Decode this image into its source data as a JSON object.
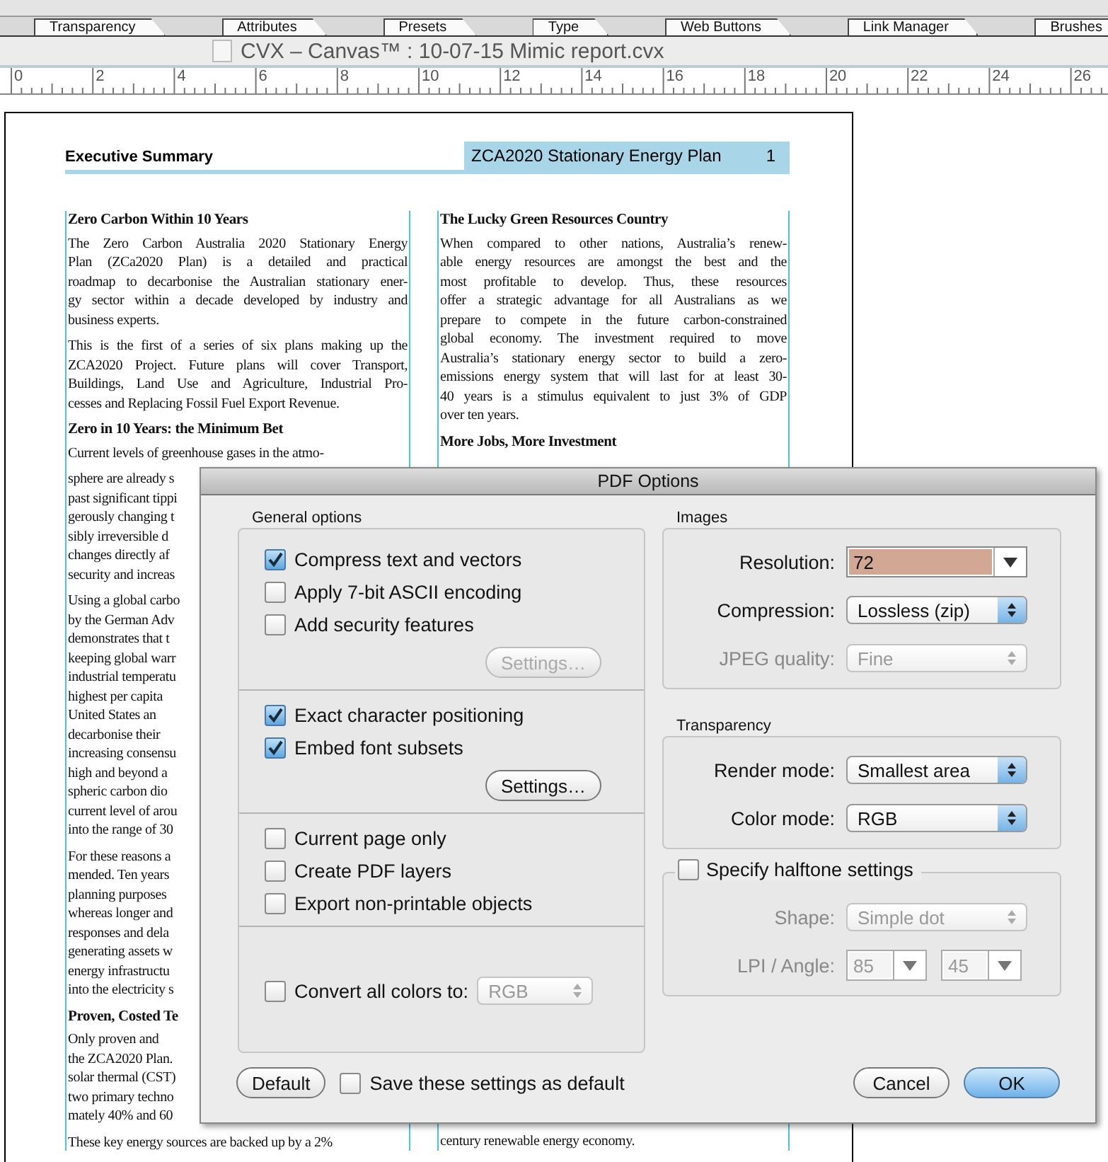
{
  "panel_tabs": [
    {
      "label": "Transparency"
    },
    {
      "label": "Attributes"
    },
    {
      "label": "Presets"
    },
    {
      "label": "Type"
    },
    {
      "label": "Web Buttons"
    },
    {
      "label": "Link Manager"
    },
    {
      "label": "Brushes"
    }
  ],
  "document_title": "CVX – Canvas™ : 10-07-15 Mimic report.cvx",
  "ruler": {
    "labels": [
      "0",
      "2",
      "4",
      "6",
      "8",
      "10",
      "12",
      "14",
      "16",
      "18",
      "20",
      "22",
      "24",
      "26"
    ]
  },
  "page": {
    "header_title": "Executive Summary",
    "running_head": "ZCA2020 Stationary Energy Plan",
    "page_number": "1",
    "left_column": [
      {
        "kind": "heading",
        "text": "Zero Carbon Within 10 Years"
      },
      {
        "kind": "paragraph",
        "lines": [
          "The Zero Carbon Australia 2020 Stationary Energy",
          "Plan (ZCa2020 Plan) is a detailed and practical",
          "roadmap to decarbonise the Australian stationary ener-",
          "gy sector within a decade developed by industry and",
          "business experts."
        ]
      },
      {
        "kind": "paragraph",
        "lines": [
          "This is the first of a series of six plans making up the",
          "ZCA2020 Project.  Future plans will cover Transport,",
          "Buildings, Land Use and Agriculture, Industrial Pro-",
          "cesses and Replacing Fossil Fuel Export Revenue."
        ]
      },
      {
        "kind": "heading",
        "text": "Zero in 10 Years: the Minimum Bet"
      },
      {
        "kind": "paragraph",
        "lines": [
          "Current levels of greenhouse gases in the atmo-"
        ]
      },
      {
        "kind": "cut_paragraph",
        "lines": [
          "sphere are already s",
          "past significant tippi",
          "gerously changing t",
          "sibly irreversible d",
          "changes directly af",
          "security and increas"
        ]
      },
      {
        "kind": "cut_paragraph",
        "lines": [
          "Using a global carbo",
          "by the German Adv",
          "demonstrates that t",
          "keeping global warr",
          "industrial temperatu",
          "highest per capita",
          "United States an",
          "decarbonise their",
          "increasing consensu",
          "high and beyond a",
          "spheric carbon dio",
          "current level of arou",
          "into the range of 30"
        ]
      },
      {
        "kind": "cut_paragraph",
        "lines": [
          "For these reasons a",
          "mended. Ten years",
          "planning purposes",
          "whereas longer and",
          "responses and dela",
          "generating assets w",
          "energy infrastructu",
          "into the electricity s"
        ]
      },
      {
        "kind": "cut_heading",
        "text": "Proven, Costed Te"
      },
      {
        "kind": "cut_paragraph",
        "lines": [
          "Only proven and",
          "the ZCA2020 Plan.",
          "solar thermal (CST)",
          "two primary techno",
          "mately 40% and 60"
        ]
      },
      {
        "kind": "paragraph",
        "lines": [
          "These key energy sources are backed up by a 2%"
        ]
      }
    ],
    "right_column": [
      {
        "kind": "heading",
        "text": "The Lucky Green Resources Country"
      },
      {
        "kind": "paragraph",
        "lines": [
          "When compared to other nations, Australia’s renew-",
          "able energy resources are amongst the best and the",
          "most profitable to develop. Thus, these resources",
          "offer a strategic advantage for all Australians as we",
          "prepare to compete in the future carbon-constrained",
          "global economy. The investment required to move",
          "Australia’s stationary energy sector to build a zero-",
          "emissions energy system that will last for at least 30-",
          "40 years is a stimulus equivalent to just 3% of GDP",
          "over ten years."
        ]
      },
      {
        "kind": "heading",
        "text": "More Jobs, More Investment"
      },
      {
        "kind": "tail",
        "lines": [
          "century renewable energy economy."
        ]
      }
    ]
  },
  "dialog": {
    "title": "PDF Options",
    "general": {
      "label": "General options",
      "sections": [
        {
          "items": [
            {
              "kind": "checkbox",
              "label": "Compress text and vectors",
              "checked": true
            },
            {
              "kind": "checkbox",
              "label": "Apply 7-bit ASCII encoding",
              "checked": false
            },
            {
              "kind": "checkbox",
              "label": "Add security features",
              "checked": false
            },
            {
              "kind": "button",
              "label": "Settings…",
              "disabled": true
            }
          ]
        },
        {
          "items": [
            {
              "kind": "checkbox",
              "label": "Exact character positioning",
              "checked": true
            },
            {
              "kind": "checkbox",
              "label": "Embed font subsets",
              "checked": true
            },
            {
              "kind": "button",
              "label": "Settings…",
              "disabled": false
            }
          ]
        },
        {
          "items": [
            {
              "kind": "checkbox",
              "label": "Current page only",
              "checked": false
            },
            {
              "kind": "checkbox",
              "label": "Create PDF layers",
              "checked": false
            },
            {
              "kind": "checkbox",
              "label": "Export non-printable objects",
              "checked": false
            }
          ]
        },
        {
          "items": [
            {
              "kind": "checkbox_select",
              "label": "Convert all colors to:",
              "checked": false,
              "value": "RGB",
              "disabled": true
            }
          ]
        }
      ]
    },
    "images": {
      "label": "Images",
      "rows": [
        {
          "kind": "combo",
          "label": "Resolution:",
          "value": "72",
          "text_selected": true,
          "disabled": false
        },
        {
          "kind": "popup",
          "label": "Compression:",
          "value": "Lossless (zip)",
          "disabled": false
        },
        {
          "kind": "popup",
          "label": "JPEG quality:",
          "value": "Fine",
          "disabled": true
        }
      ]
    },
    "transparency": {
      "label": "Transparency",
      "rows": [
        {
          "kind": "popup",
          "label": "Render mode:",
          "value": "Smallest area",
          "disabled": false
        },
        {
          "kind": "popup",
          "label": "Color mode:",
          "value": "RGB",
          "disabled": false
        }
      ]
    },
    "halftone": {
      "label": "Specify halftone settings",
      "checked": false,
      "rows": [
        {
          "kind": "popup",
          "label": "Shape:",
          "value": "Simple dot",
          "disabled": true
        },
        {
          "kind": "combo_pair",
          "label": "LPI / Angle:",
          "values": [
            "85",
            "45"
          ],
          "disabled": true
        }
      ]
    },
    "footer": {
      "default_button": "Default",
      "save_default": {
        "label": "Save these settings as default",
        "checked": false
      },
      "buttons": [
        {
          "label": "Cancel",
          "default": false
        },
        {
          "label": "OK",
          "default": true
        }
      ]
    }
  }
}
